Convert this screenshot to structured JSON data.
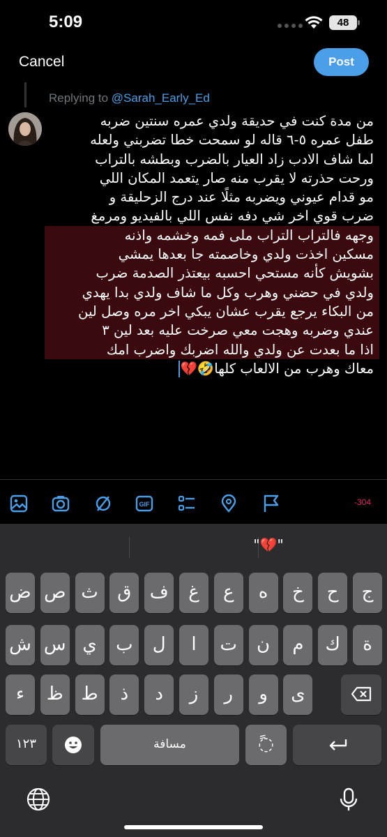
{
  "status_bar": {
    "time": "5:09",
    "battery": "48"
  },
  "header": {
    "cancel_label": "Cancel",
    "post_label": "Post"
  },
  "reply": {
    "prefix": "Replying to ",
    "handle": "@Sarah_Early_Ed"
  },
  "tweet_lines": [
    "من مدة كنت في حديقة ولدي عمره سنتين ضربه",
    "طفل عمره ٥-٦ قاله لو سمحت خطا تضربني ولعله",
    "لما شاف الادب زاد العيار بالضرب وبطشه بالتراب",
    "ورحت حذرته لا يقرب منه صار يتعمد المكان اللي",
    "مو قدام عيوني ويضربه مثلًا عند درج الزحليقة و",
    "ضرب قوي اخر شي دفه نفس اللي بالفيديو ومرمغ",
    "وجهه فالتراب التراب ملى فمه وخشمه واذنه",
    "مسكين اخذت ولدي وخاصمته جا بعدها يمشي",
    "بشويش كأنه مستحي احسبه بيعتذر الصدمة ضرب",
    "ولدي في حضني وهرب وكل ما شاف ولدي بدا يهدي",
    "من البكاء يرجع يقرب عشان يبكي اخر مره وصل لين",
    "عندي وضربه وهجت معي صرخت عليه بعد لين ٣",
    "اذا ما بعدت عن ولدي والله اضربك واضرب امك",
    "معاك وهرب من الالعاب كلها🤣💔"
  ],
  "char_counter": "-304",
  "toolbar_icons": [
    "image-icon",
    "camera-icon",
    "no-icon",
    "gif-icon",
    "poll-icon",
    "location-icon",
    "flag-icon"
  ],
  "keyboard": {
    "prediction": "\"💔\"",
    "row1": [
      "ض",
      "ص",
      "ث",
      "ق",
      "ف",
      "غ",
      "ع",
      "ه",
      "خ",
      "ح",
      "ج"
    ],
    "row2": [
      "ش",
      "س",
      "ي",
      "ب",
      "ل",
      "ا",
      "ت",
      "ن",
      "م",
      "ك",
      "ة"
    ],
    "row3": [
      "ء",
      "ظ",
      "ط",
      "ذ",
      "د",
      "ز",
      "ر",
      "و",
      "ى"
    ],
    "numbers_label": "١٢٣",
    "space_label": "مسافة",
    "diacritic_label": "ً◌"
  },
  "colors": {
    "accent": "#4a9fe8",
    "highlight": "#3b0a0f",
    "counter": "#e0245e",
    "key": "#6b6b6d",
    "key_dark": "#464648"
  }
}
